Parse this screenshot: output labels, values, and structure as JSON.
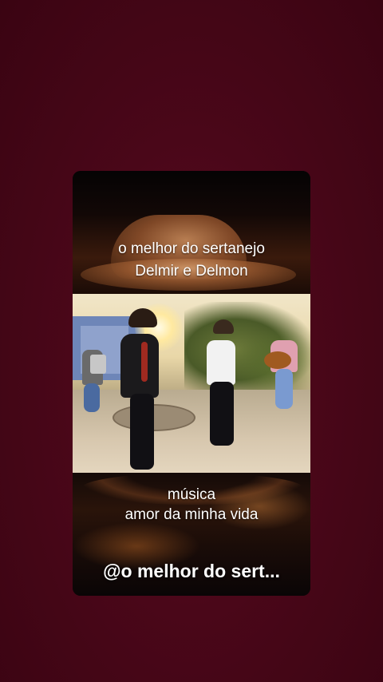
{
  "overlay": {
    "line1": "o melhor do sertanejo",
    "line2": "Delmir e Delmon",
    "music_label": "música",
    "song_title": "amor da minha vida",
    "channel_handle": "@o melhor do sert..."
  },
  "colors": {
    "background": "#4a0719",
    "text": "#ffffff"
  }
}
